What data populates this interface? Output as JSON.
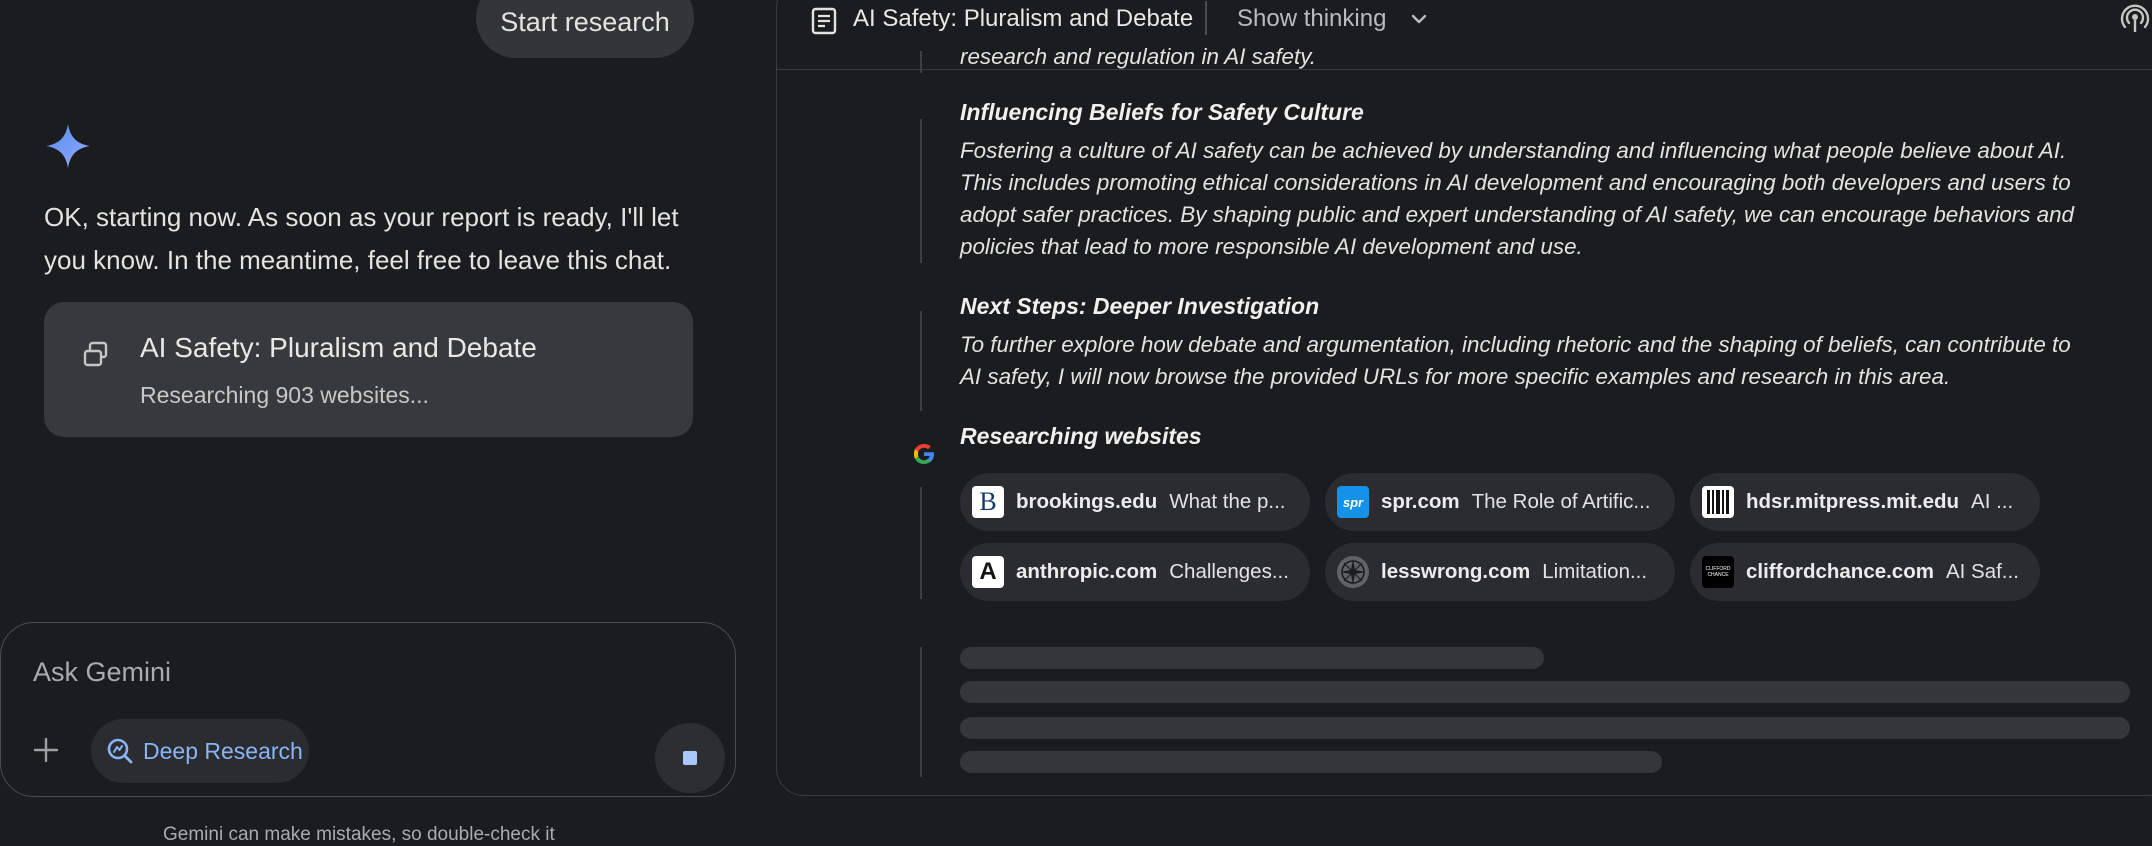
{
  "chat": {
    "start_research_label": "Start research",
    "ai_message": "OK, starting now. As soon as your report is ready, I'll let you know. In the meantime, feel free to leave this chat.",
    "report_card": {
      "title": "AI Safety: Pluralism and Debate",
      "status": "Researching 903 websites..."
    },
    "composer": {
      "placeholder": "Ask Gemini",
      "deep_research_label": "Deep Research"
    },
    "disclaimer": "Gemini can make mistakes, so double-check it"
  },
  "report": {
    "header": {
      "title": "AI Safety: Pluralism and Debate",
      "show_thinking_label": "Show thinking"
    },
    "truncated_top_text": "research and regulation in AI safety.",
    "sections": [
      {
        "heading": "Influencing Beliefs for Safety Culture",
        "lines": [
          "Fostering a culture of AI safety can be achieved by understanding and influencing what people believe about AI.",
          "This includes promoting ethical considerations in AI development and encouraging both developers and users to",
          "adopt safer practices. By shaping public and expert understanding of AI safety, we can encourage behaviors and",
          "policies that lead to more responsible AI development and use."
        ]
      },
      {
        "heading": "Next Steps: Deeper Investigation",
        "lines": [
          "To further explore how debate and argumentation, including rhetoric and the shaping of beliefs, can contribute to",
          "AI safety, I will now browse the provided URLs for more specific examples and research in this area."
        ]
      }
    ],
    "researching_label": "Researching websites",
    "websites": [
      {
        "domain": "brookings.edu",
        "desc": "What the p...",
        "icon": "brookings-favicon"
      },
      {
        "domain": "spr.com",
        "desc": "The Role of Artific...",
        "icon": "spr-favicon"
      },
      {
        "domain": "hdsr.mitpress.mit.edu",
        "desc": "AI ...",
        "icon": "hdsr-favicon"
      },
      {
        "domain": "anthropic.com",
        "desc": "Challenges...",
        "icon": "anthropic-favicon"
      },
      {
        "domain": "lesswrong.com",
        "desc": "Limitation...",
        "icon": "lesswrong-favicon"
      },
      {
        "domain": "cliffordchance.com",
        "desc": "AI Saf...",
        "icon": "cliffordchance-favicon"
      }
    ],
    "favicon_text": {
      "brookings": "B",
      "spr": "spr",
      "anthropic": "A",
      "cliffordchance": "CLIFFORD CHANCE"
    }
  },
  "colors": {
    "background": "#1b1c1d",
    "accent_blue": "#8ab4f8",
    "chip_bg": "#2a2c2f",
    "card_bg": "#37393b"
  }
}
